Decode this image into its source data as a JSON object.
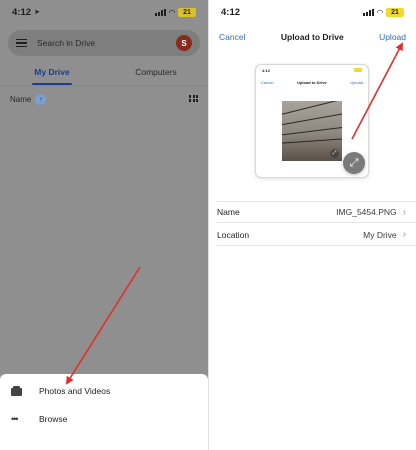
{
  "left": {
    "status": {
      "time": "4:12",
      "battery": "21"
    },
    "search_placeholder": "Search in Drive",
    "avatar_initial": "S",
    "tabs": [
      {
        "label": "My Drive",
        "active": true
      },
      {
        "label": "Computers",
        "active": false
      }
    ],
    "sort_label": "Name",
    "sheet": {
      "items": [
        {
          "label": "Photos and Videos",
          "icon": "photo-album-icon"
        },
        {
          "label": "Browse",
          "icon": "more-dots-icon"
        }
      ]
    }
  },
  "right": {
    "status": {
      "time": "4:12",
      "battery": "21"
    },
    "nav": {
      "cancel": "Cancel",
      "title": "Upload to Drive",
      "upload": "Upload"
    },
    "thumbnail": {
      "time": "4:12",
      "cancel": "Cancel",
      "title": "Upload to Drive",
      "upload": "Upload"
    },
    "fields": [
      {
        "key": "Name",
        "value": "IMG_5454.PNG"
      },
      {
        "key": "Location",
        "value": "My Drive"
      }
    ]
  },
  "colors": {
    "accent_blue": "#2f6ec7",
    "battery_yellow": "#f2d930",
    "annotation_red": "#e0302a",
    "dim_overlay": "#8f8f8f"
  }
}
